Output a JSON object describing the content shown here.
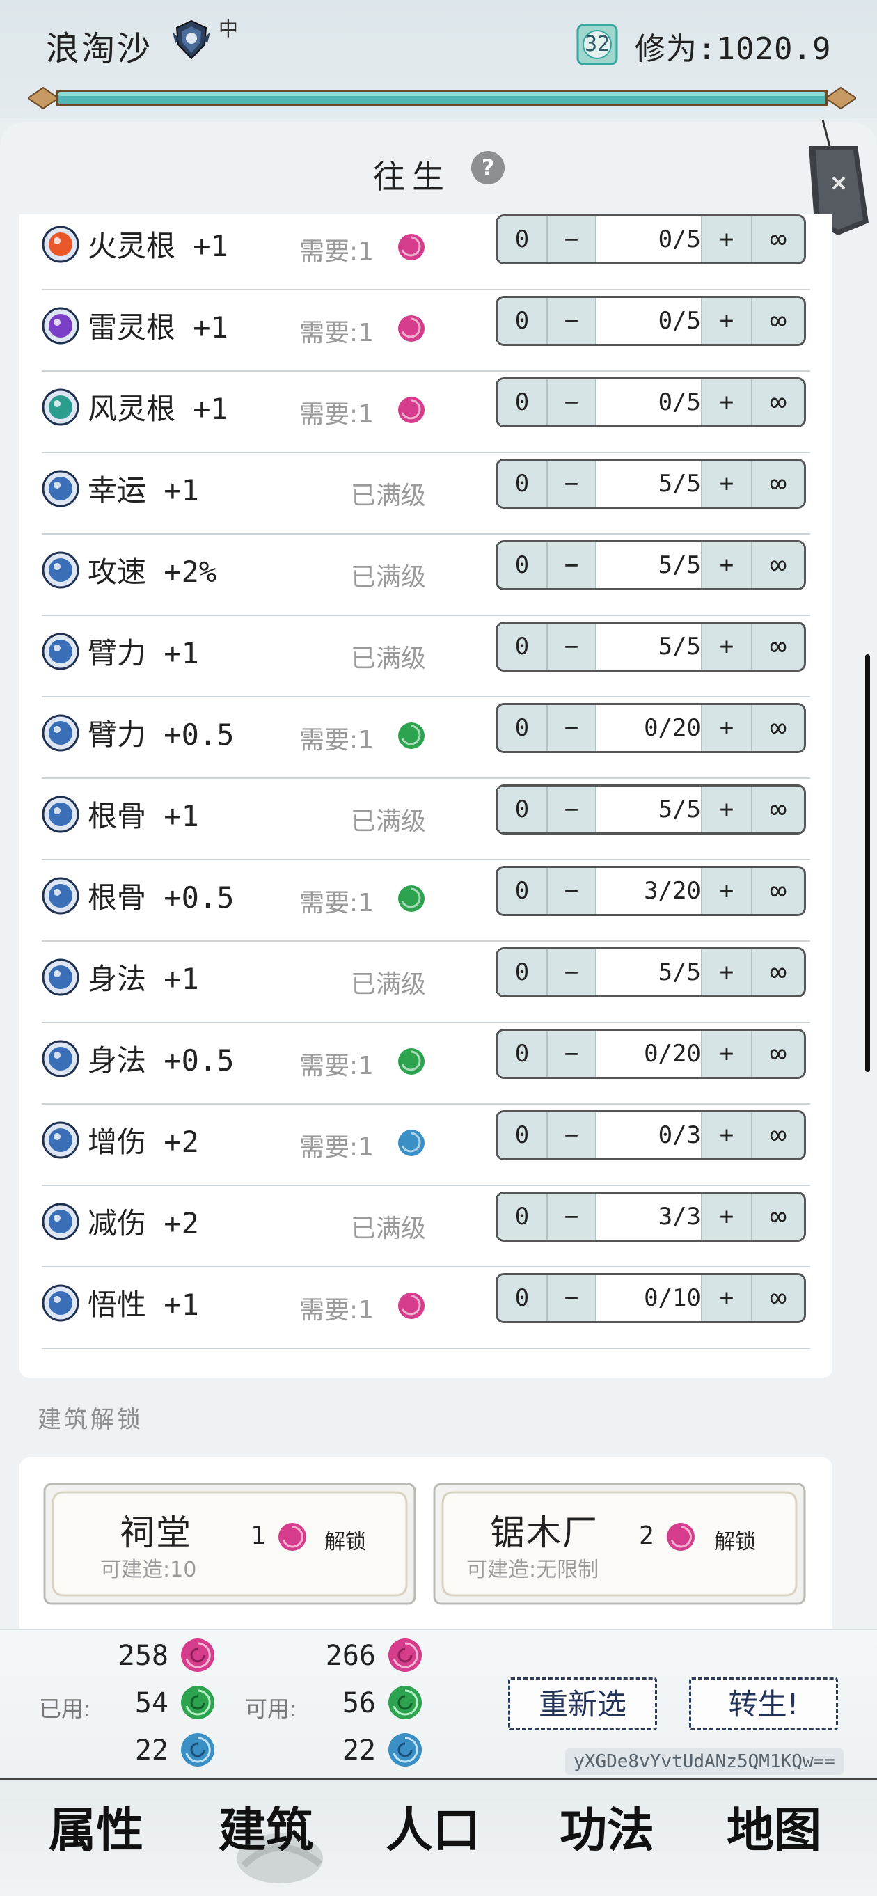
{
  "header": {
    "name": "浪淘沙",
    "rank_sub": "中",
    "level": "32",
    "cultivation_label": "修为:1020.9"
  },
  "panel": {
    "title": "往生"
  },
  "rows": [
    {
      "label": "火灵根 +1",
      "icon": "fire-root-icon",
      "need": "需要:1",
      "orb": "pink",
      "count": "0/5",
      "maxed": false
    },
    {
      "label": "雷灵根 +1",
      "icon": "thunder-root-icon",
      "need": "需要:1",
      "orb": "pink",
      "count": "0/5",
      "maxed": false
    },
    {
      "label": "风灵根 +1",
      "icon": "wind-root-icon",
      "need": "需要:1",
      "orb": "pink",
      "count": "0/5",
      "maxed": false
    },
    {
      "label": "幸运 +1",
      "icon": "luck-icon",
      "need": "已满级",
      "orb": "",
      "count": "5/5",
      "maxed": true
    },
    {
      "label": "攻速 +2%",
      "icon": "attack-speed-icon",
      "need": "已满级",
      "orb": "",
      "count": "5/5",
      "maxed": true
    },
    {
      "label": "臂力 +1",
      "icon": "strength-icon",
      "need": "已满级",
      "orb": "",
      "count": "5/5",
      "maxed": true
    },
    {
      "label": "臂力 +0.5",
      "icon": "strength-icon",
      "need": "需要:1",
      "orb": "green",
      "count": "0/20",
      "maxed": false
    },
    {
      "label": "根骨 +1",
      "icon": "constitution-icon",
      "need": "已满级",
      "orb": "",
      "count": "5/5",
      "maxed": true
    },
    {
      "label": "根骨 +0.5",
      "icon": "constitution-icon",
      "need": "需要:1",
      "orb": "green",
      "count": "3/20",
      "maxed": false
    },
    {
      "label": "身法 +1",
      "icon": "agility-icon",
      "need": "已满级",
      "orb": "",
      "count": "5/5",
      "maxed": true
    },
    {
      "label": "身法 +0.5",
      "icon": "agility-icon",
      "need": "需要:1",
      "orb": "green",
      "count": "0/20",
      "maxed": false
    },
    {
      "label": "增伤 +2",
      "icon": "damage-up-icon",
      "need": "需要:1",
      "orb": "blue",
      "count": "0/3",
      "maxed": false
    },
    {
      "label": "减伤 +2",
      "icon": "damage-down-icon",
      "need": "已满级",
      "orb": "",
      "count": "3/3",
      "maxed": true
    },
    {
      "label": "悟性 +1",
      "icon": "insight-icon",
      "need": "需要:1",
      "orb": "pink",
      "count": "0/10",
      "maxed": false
    }
  ],
  "stepper": {
    "zero": "0",
    "minus": "−",
    "plus": "+",
    "inf": "∞"
  },
  "buildings": {
    "section_label": "建筑解锁",
    "items": [
      {
        "name": "祠堂",
        "limit": "可建造:10",
        "cost": "1",
        "unlock": "解锁"
      },
      {
        "name": "锯木厂",
        "limit": "可建造:无限制",
        "cost": "2",
        "unlock": "解锁"
      }
    ]
  },
  "resources": {
    "used_label": "已用:",
    "avail_label": "可用:",
    "used": [
      "258",
      "54",
      "22"
    ],
    "available": [
      "266",
      "56",
      "22"
    ]
  },
  "actions": {
    "reroll": "重新选",
    "rebirth": "转生!"
  },
  "seed": "yXGDe8vYvtUdANz5QM1KQw==",
  "nav": [
    "属性",
    "建筑",
    "人口",
    "功法",
    "地图"
  ],
  "colors": {
    "pink": "#d63c8c",
    "green": "#2da24f",
    "blue": "#3a8fc4",
    "button_bg": "#d6e4e5",
    "accent": "#3aa6a0"
  }
}
